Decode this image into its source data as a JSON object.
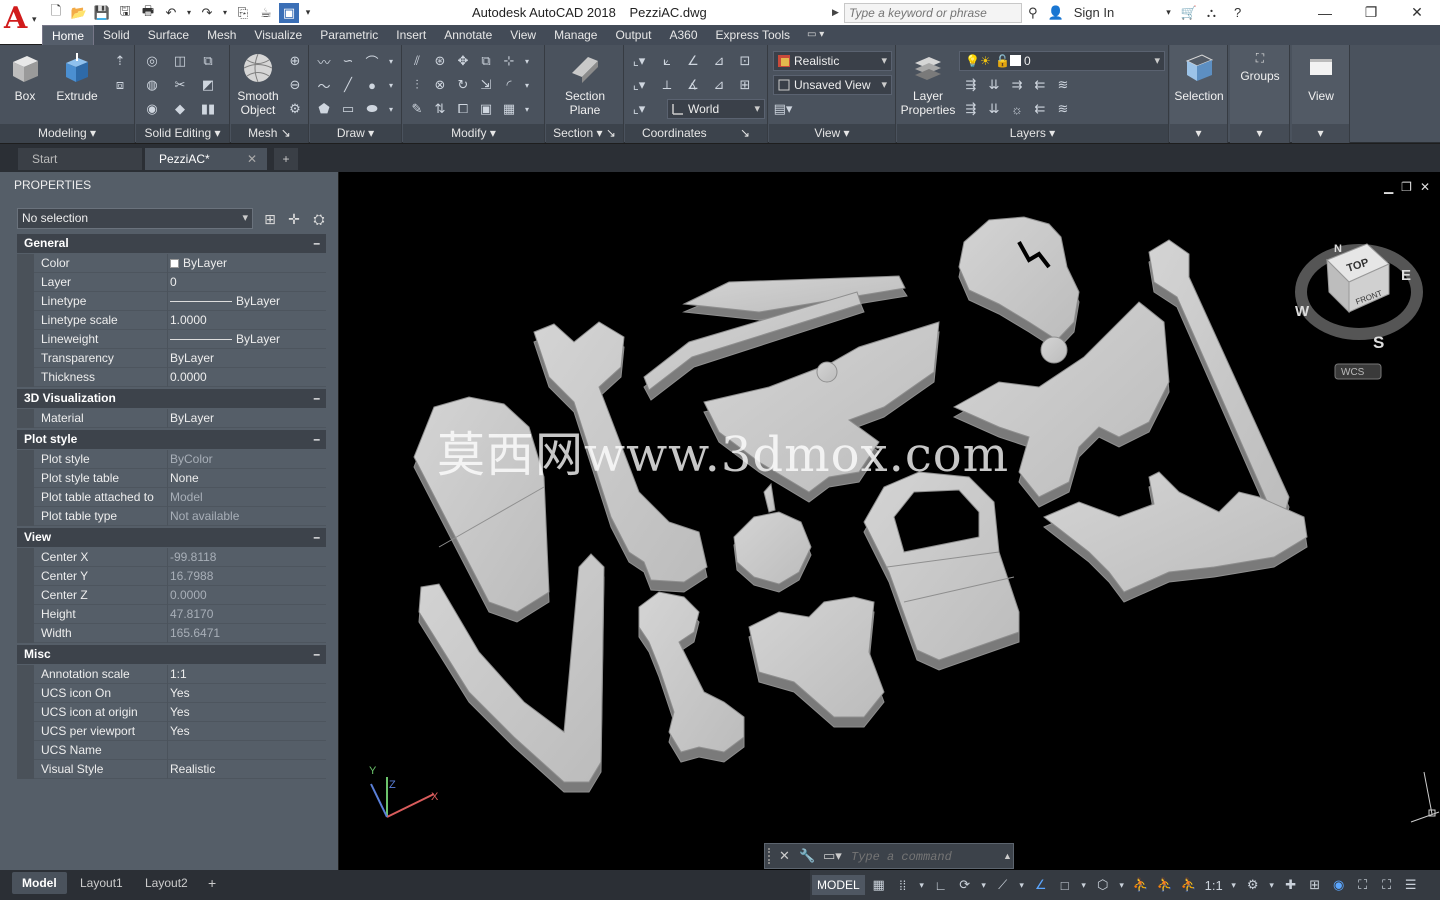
{
  "app": {
    "logo_letter": "A",
    "title_app": "Autodesk AutoCAD 2018",
    "title_file": "PezziAC.dwg"
  },
  "search": {
    "placeholder": "Type a keyword or phrase"
  },
  "account": {
    "sign_in": "Sign In"
  },
  "ribbon_tabs": [
    "Home",
    "Solid",
    "Surface",
    "Mesh",
    "Visualize",
    "Parametric",
    "Insert",
    "Annotate",
    "View",
    "Manage",
    "Output",
    "A360",
    "Express Tools"
  ],
  "ribbon": {
    "buttons": {
      "box": "Box",
      "extrude": "Extrude",
      "smooth_object_1": "Smooth",
      "smooth_object_2": "Object",
      "section_plane_1": "Section",
      "section_plane_2": "Plane",
      "layer_props_1": "Layer",
      "layer_props_2": "Properties",
      "selection": "Selection",
      "groups": "Groups",
      "view": "View"
    },
    "panels": {
      "modeling": "Modeling",
      "solid_editing": "Solid Editing",
      "mesh": "Mesh",
      "draw": "Draw",
      "modify": "Modify",
      "section": "Section",
      "coordinates": "Coordinates",
      "view": "View",
      "layers": "Layers"
    },
    "visual_style": "Realistic",
    "named_view": "Unsaved View",
    "ucs": "World",
    "layer_current": "0"
  },
  "file_tabs": {
    "start": "Start",
    "doc": "PezziAC*"
  },
  "properties": {
    "title": "PROPERTIES",
    "selection": "No selection",
    "sections": {
      "general": "General",
      "viz": "3D Visualization",
      "plot": "Plot style",
      "view": "View",
      "misc": "Misc"
    },
    "general": [
      {
        "k": "Color",
        "v": "ByLayer"
      },
      {
        "k": "Layer",
        "v": "0"
      },
      {
        "k": "Linetype",
        "v": "ByLayer"
      },
      {
        "k": "Linetype scale",
        "v": "1.0000"
      },
      {
        "k": "Lineweight",
        "v": "ByLayer"
      },
      {
        "k": "Transparency",
        "v": "ByLayer"
      },
      {
        "k": "Thickness",
        "v": "0.0000"
      }
    ],
    "viz": [
      {
        "k": "Material",
        "v": "ByLayer"
      }
    ],
    "plot": [
      {
        "k": "Plot style",
        "v": "ByColor"
      },
      {
        "k": "Plot style table",
        "v": "None"
      },
      {
        "k": "Plot table attached to",
        "v": "Model"
      },
      {
        "k": "Plot table type",
        "v": "Not available"
      }
    ],
    "view": [
      {
        "k": "Center X",
        "v": "-99.8118"
      },
      {
        "k": "Center Y",
        "v": "16.7988"
      },
      {
        "k": "Center Z",
        "v": "0.0000"
      },
      {
        "k": "Height",
        "v": "47.8170"
      },
      {
        "k": "Width",
        "v": "165.6471"
      }
    ],
    "misc": [
      {
        "k": "Annotation scale",
        "v": "1:1"
      },
      {
        "k": "UCS icon On",
        "v": "Yes"
      },
      {
        "k": "UCS icon at origin",
        "v": "Yes"
      },
      {
        "k": "UCS per viewport",
        "v": "Yes"
      },
      {
        "k": "UCS Name",
        "v": ""
      },
      {
        "k": "Visual Style",
        "v": "Realistic"
      }
    ]
  },
  "viewport": {
    "watermark": "莫西网www.3dmox.com",
    "viewcube": {
      "top": "TOP",
      "front": "FRONT",
      "n": "N",
      "s": "S",
      "e": "E",
      "w": "W",
      "wcs": "WCS"
    },
    "ucs_icon": {
      "x": "X",
      "y": "Y",
      "z": "Z"
    }
  },
  "command": {
    "placeholder": "Type a command"
  },
  "status": {
    "layouts": [
      "Model",
      "Layout1",
      "Layout2"
    ],
    "model": "MODEL",
    "scale": "1:1"
  },
  "colors": {
    "ribbon_bg": "#4a525d",
    "palette_bg": "#555e68",
    "viewport_bg": "#000000",
    "accent": "#3b6fb6",
    "brand_red": "#d11b1b"
  }
}
